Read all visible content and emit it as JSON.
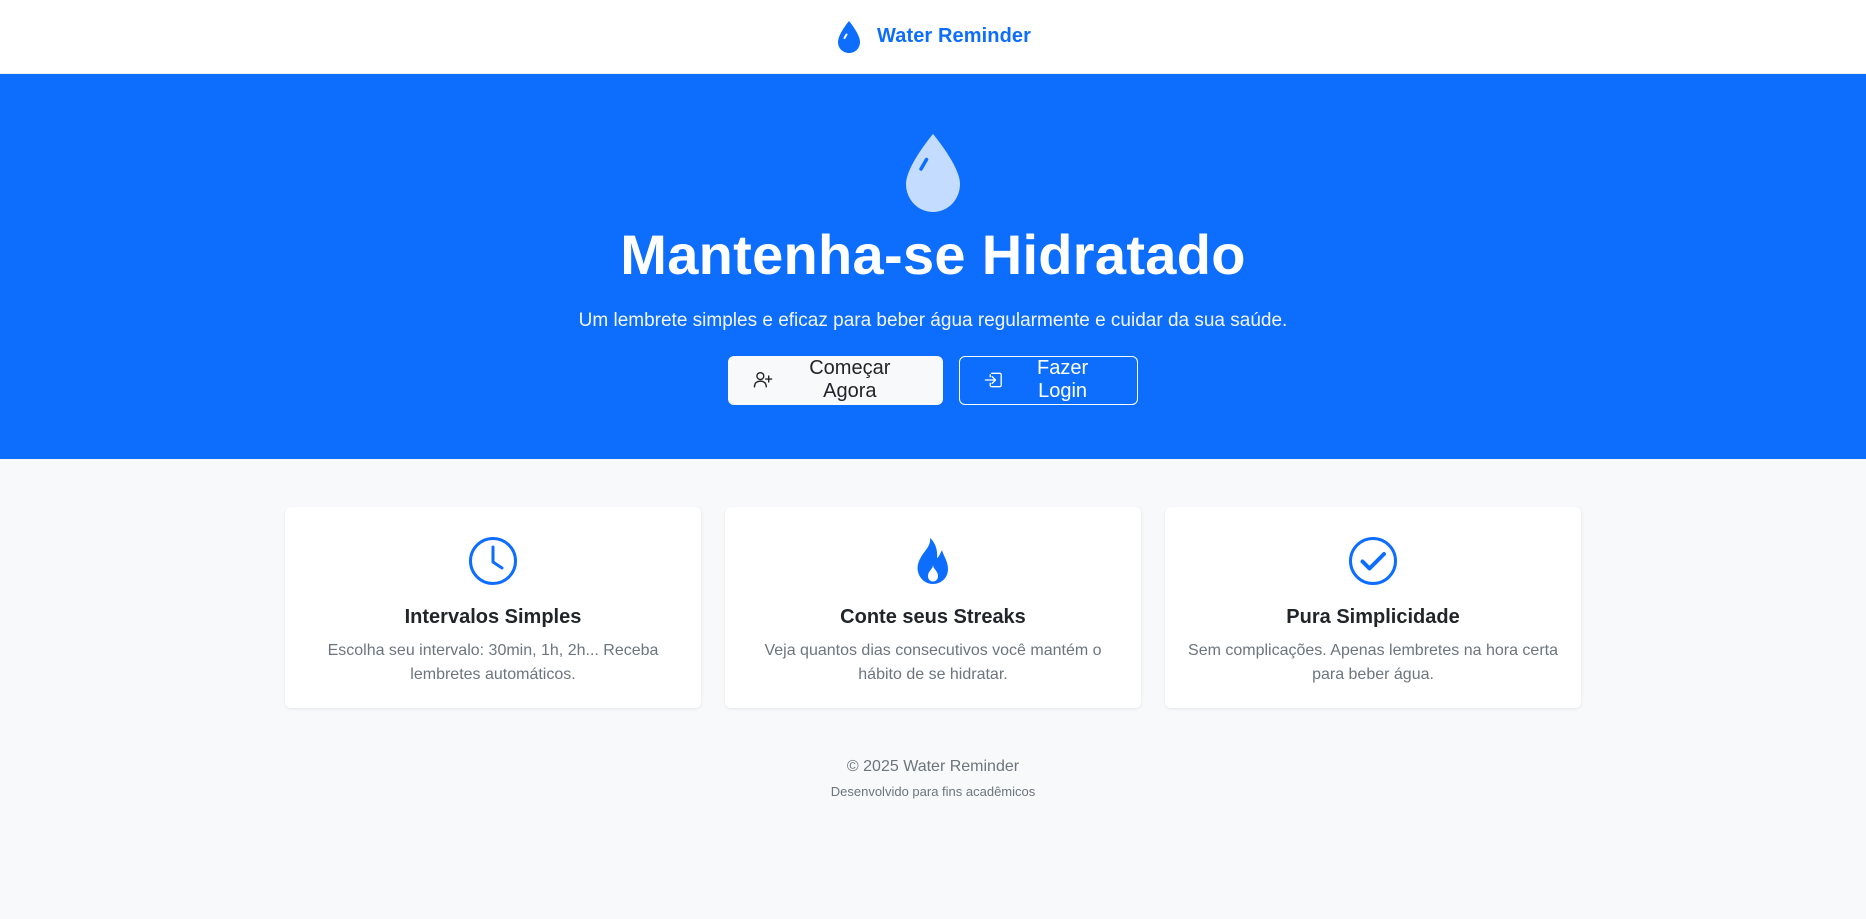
{
  "navbar": {
    "brand_icon": "droplet-icon",
    "brand_text": "Water Reminder",
    "brand_color": "#0d6efd"
  },
  "hero": {
    "icon": "droplet-icon",
    "title": "Mantenha-se Hidratado",
    "subtitle": "Um lembrete simples e eficaz para beber água regularmente e cuidar da sua saúde.",
    "background": "#0d6efd",
    "actions": {
      "start": {
        "icon": "person-plus-icon",
        "label": "Começar Agora"
      },
      "login": {
        "icon": "box-arrow-in-right-icon",
        "label": "Fazer Login"
      }
    }
  },
  "features": [
    {
      "icon": "clock-icon",
      "title": "Intervalos Simples",
      "text": "Escolha seu intervalo: 30min, 1h, 2h... Receba lembretes automáticos."
    },
    {
      "icon": "fire-icon",
      "title": "Conte seus Streaks",
      "text": "Veja quantos dias consecutivos você mantém o hábito de se hidratar."
    },
    {
      "icon": "check-circle-icon",
      "title": "Pura Simplicidade",
      "text": "Sem complicações. Apenas lembretes na hora certa para beber água."
    }
  ],
  "footer": {
    "copyright": "© 2025 Water Reminder",
    "note": "Desenvolvido para fins acadêmicos"
  }
}
